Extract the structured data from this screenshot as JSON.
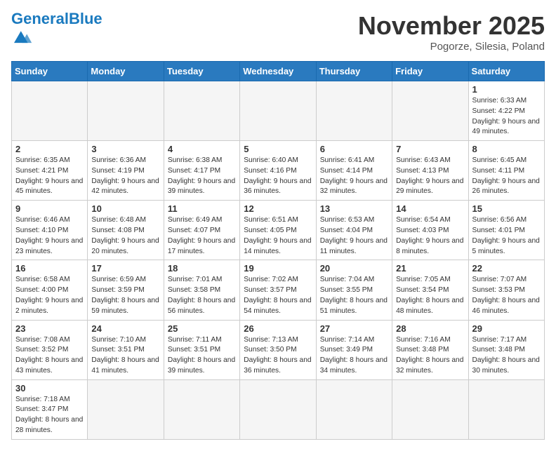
{
  "header": {
    "logo_general": "General",
    "logo_blue": "Blue",
    "month_title": "November 2025",
    "location": "Pogorze, Silesia, Poland"
  },
  "days_of_week": [
    "Sunday",
    "Monday",
    "Tuesday",
    "Wednesday",
    "Thursday",
    "Friday",
    "Saturday"
  ],
  "weeks": [
    [
      {
        "day": "",
        "info": ""
      },
      {
        "day": "",
        "info": ""
      },
      {
        "day": "",
        "info": ""
      },
      {
        "day": "",
        "info": ""
      },
      {
        "day": "",
        "info": ""
      },
      {
        "day": "",
        "info": ""
      },
      {
        "day": "1",
        "info": "Sunrise: 6:33 AM\nSunset: 4:22 PM\nDaylight: 9 hours and 49 minutes."
      }
    ],
    [
      {
        "day": "2",
        "info": "Sunrise: 6:35 AM\nSunset: 4:21 PM\nDaylight: 9 hours and 45 minutes."
      },
      {
        "day": "3",
        "info": "Sunrise: 6:36 AM\nSunset: 4:19 PM\nDaylight: 9 hours and 42 minutes."
      },
      {
        "day": "4",
        "info": "Sunrise: 6:38 AM\nSunset: 4:17 PM\nDaylight: 9 hours and 39 minutes."
      },
      {
        "day": "5",
        "info": "Sunrise: 6:40 AM\nSunset: 4:16 PM\nDaylight: 9 hours and 36 minutes."
      },
      {
        "day": "6",
        "info": "Sunrise: 6:41 AM\nSunset: 4:14 PM\nDaylight: 9 hours and 32 minutes."
      },
      {
        "day": "7",
        "info": "Sunrise: 6:43 AM\nSunset: 4:13 PM\nDaylight: 9 hours and 29 minutes."
      },
      {
        "day": "8",
        "info": "Sunrise: 6:45 AM\nSunset: 4:11 PM\nDaylight: 9 hours and 26 minutes."
      }
    ],
    [
      {
        "day": "9",
        "info": "Sunrise: 6:46 AM\nSunset: 4:10 PM\nDaylight: 9 hours and 23 minutes."
      },
      {
        "day": "10",
        "info": "Sunrise: 6:48 AM\nSunset: 4:08 PM\nDaylight: 9 hours and 20 minutes."
      },
      {
        "day": "11",
        "info": "Sunrise: 6:49 AM\nSunset: 4:07 PM\nDaylight: 9 hours and 17 minutes."
      },
      {
        "day": "12",
        "info": "Sunrise: 6:51 AM\nSunset: 4:05 PM\nDaylight: 9 hours and 14 minutes."
      },
      {
        "day": "13",
        "info": "Sunrise: 6:53 AM\nSunset: 4:04 PM\nDaylight: 9 hours and 11 minutes."
      },
      {
        "day": "14",
        "info": "Sunrise: 6:54 AM\nSunset: 4:03 PM\nDaylight: 9 hours and 8 minutes."
      },
      {
        "day": "15",
        "info": "Sunrise: 6:56 AM\nSunset: 4:01 PM\nDaylight: 9 hours and 5 minutes."
      }
    ],
    [
      {
        "day": "16",
        "info": "Sunrise: 6:58 AM\nSunset: 4:00 PM\nDaylight: 9 hours and 2 minutes."
      },
      {
        "day": "17",
        "info": "Sunrise: 6:59 AM\nSunset: 3:59 PM\nDaylight: 8 hours and 59 minutes."
      },
      {
        "day": "18",
        "info": "Sunrise: 7:01 AM\nSunset: 3:58 PM\nDaylight: 8 hours and 56 minutes."
      },
      {
        "day": "19",
        "info": "Sunrise: 7:02 AM\nSunset: 3:57 PM\nDaylight: 8 hours and 54 minutes."
      },
      {
        "day": "20",
        "info": "Sunrise: 7:04 AM\nSunset: 3:55 PM\nDaylight: 8 hours and 51 minutes."
      },
      {
        "day": "21",
        "info": "Sunrise: 7:05 AM\nSunset: 3:54 PM\nDaylight: 8 hours and 48 minutes."
      },
      {
        "day": "22",
        "info": "Sunrise: 7:07 AM\nSunset: 3:53 PM\nDaylight: 8 hours and 46 minutes."
      }
    ],
    [
      {
        "day": "23",
        "info": "Sunrise: 7:08 AM\nSunset: 3:52 PM\nDaylight: 8 hours and 43 minutes."
      },
      {
        "day": "24",
        "info": "Sunrise: 7:10 AM\nSunset: 3:51 PM\nDaylight: 8 hours and 41 minutes."
      },
      {
        "day": "25",
        "info": "Sunrise: 7:11 AM\nSunset: 3:51 PM\nDaylight: 8 hours and 39 minutes."
      },
      {
        "day": "26",
        "info": "Sunrise: 7:13 AM\nSunset: 3:50 PM\nDaylight: 8 hours and 36 minutes."
      },
      {
        "day": "27",
        "info": "Sunrise: 7:14 AM\nSunset: 3:49 PM\nDaylight: 8 hours and 34 minutes."
      },
      {
        "day": "28",
        "info": "Sunrise: 7:16 AM\nSunset: 3:48 PM\nDaylight: 8 hours and 32 minutes."
      },
      {
        "day": "29",
        "info": "Sunrise: 7:17 AM\nSunset: 3:48 PM\nDaylight: 8 hours and 30 minutes."
      }
    ],
    [
      {
        "day": "30",
        "info": "Sunrise: 7:18 AM\nSunset: 3:47 PM\nDaylight: 8 hours and 28 minutes."
      },
      {
        "day": "",
        "info": ""
      },
      {
        "day": "",
        "info": ""
      },
      {
        "day": "",
        "info": ""
      },
      {
        "day": "",
        "info": ""
      },
      {
        "day": "",
        "info": ""
      },
      {
        "day": "",
        "info": ""
      }
    ]
  ]
}
